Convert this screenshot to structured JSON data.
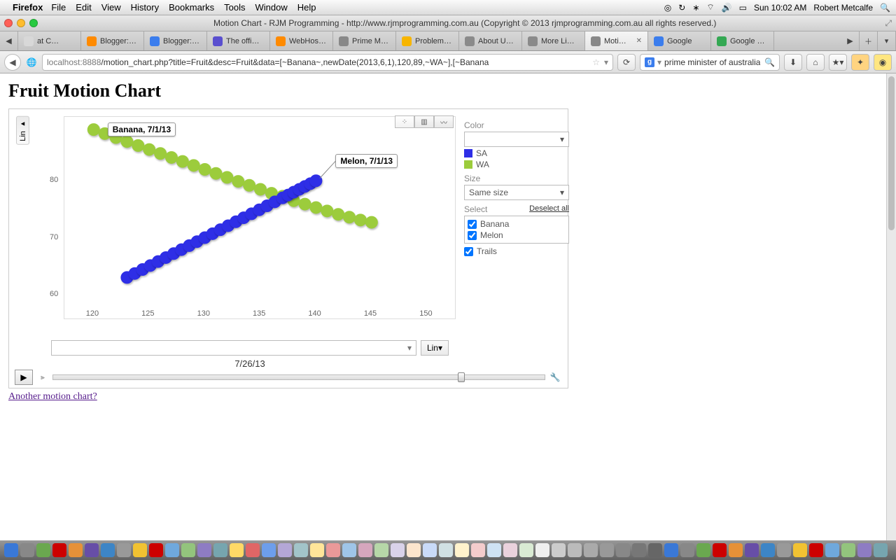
{
  "menubar": {
    "app": "Firefox",
    "items": [
      "File",
      "Edit",
      "View",
      "History",
      "Bookmarks",
      "Tools",
      "Window",
      "Help"
    ],
    "clock": "Sun 10:02 AM",
    "user": "Robert Metcalfe"
  },
  "window": {
    "title": "Motion Chart - RJM Programming - http://www.rjmprogramming.com.au (Copyright © 2013 rjmprogramming.com.au all rights reserved.)"
  },
  "tabs": {
    "items": [
      {
        "label": "at C…",
        "fav": "#d8d8d8"
      },
      {
        "label": "Blogger:…",
        "fav": "#ff8a00"
      },
      {
        "label": "Blogger:…",
        "fav": "#3b7ded"
      },
      {
        "label": "The offi…",
        "fav": "#5a4fcf"
      },
      {
        "label": "WebHos…",
        "fav": "#ff8a00"
      },
      {
        "label": "Prime M…",
        "fav": "#888"
      },
      {
        "label": "Problem…",
        "fav": "#f7b500"
      },
      {
        "label": "About U…",
        "fav": "#8a8a8a"
      },
      {
        "label": "More Li…",
        "fav": "#8a8a8a"
      },
      {
        "label": "Moti…",
        "fav": "#888",
        "active": true,
        "close": true
      },
      {
        "label": "Google",
        "fav": "#3b7ded"
      },
      {
        "label": "Google …",
        "fav": "#34a853"
      }
    ]
  },
  "url": {
    "host": "localhost",
    "port": ":8888",
    "path": "/motion_chart.php?title=Fruit&desc=Fruit&data=[~Banana~,newDate(2013,6,1),120,89,~WA~],[~Banana"
  },
  "search": {
    "engine_icon": "g",
    "query": "prime minister of australia"
  },
  "page": {
    "title": "Fruit Motion Chart",
    "link": "Another motion chart?"
  },
  "panel": {
    "color_label": "Color",
    "legend": [
      {
        "name": "SA",
        "color": "#2e2ee6"
      },
      {
        "name": "WA",
        "color": "#9ccc3c"
      }
    ],
    "size_label": "Size",
    "size_value": "Same size",
    "select_label": "Select",
    "deselect": "Deselect all",
    "items": [
      {
        "name": "Banana",
        "checked": true
      },
      {
        "name": "Melon",
        "checked": true
      }
    ],
    "trails": {
      "label": "Trails",
      "checked": true
    }
  },
  "axis": {
    "y_scale": "Lin",
    "x_scale": "Lin",
    "x_ticks": [
      120,
      125,
      130,
      135,
      140,
      145,
      150
    ],
    "y_ticks": [
      60,
      70,
      80
    ]
  },
  "timeline": {
    "date": "7/26/13",
    "pos": 0.83
  },
  "tooltips": {
    "banana": "Banana, 7/1/13",
    "melon": "Melon, 7/1/13"
  },
  "chart_data": {
    "type": "scatter",
    "title": "Fruit Motion Chart",
    "xlabel": "",
    "ylabel": "",
    "xlim": [
      118,
      152
    ],
    "ylim": [
      58,
      90
    ],
    "series": [
      {
        "name": "Banana (WA)",
        "color": "#9ccc3c",
        "points": [
          [
            120,
            89
          ],
          [
            121,
            88.3
          ],
          [
            122,
            87.6
          ],
          [
            123,
            86.9
          ],
          [
            124,
            86.2
          ],
          [
            125,
            85.5
          ],
          [
            126,
            84.8
          ],
          [
            127,
            84.1
          ],
          [
            128,
            83.4
          ],
          [
            129,
            82.7
          ],
          [
            130,
            82
          ],
          [
            131,
            81.3
          ],
          [
            132,
            80.6
          ],
          [
            133,
            79.9
          ],
          [
            134,
            79.2
          ],
          [
            135,
            78.5
          ],
          [
            136,
            77.8
          ],
          [
            137,
            77.3
          ],
          [
            138,
            76.5
          ],
          [
            139,
            75.9
          ],
          [
            140,
            75.3
          ],
          [
            141,
            74.7
          ],
          [
            142,
            74.1
          ],
          [
            143,
            73.6
          ],
          [
            144,
            73.1
          ],
          [
            145,
            72.7
          ]
        ]
      },
      {
        "name": "Melon (SA)",
        "color": "#2e2ee6",
        "points": [
          [
            123,
            63
          ],
          [
            123.7,
            63.7
          ],
          [
            124.4,
            64.4
          ],
          [
            125.1,
            65.1
          ],
          [
            125.8,
            65.8
          ],
          [
            126.5,
            66.5
          ],
          [
            127.2,
            67.2
          ],
          [
            127.9,
            67.9
          ],
          [
            128.6,
            68.6
          ],
          [
            129.3,
            69.3
          ],
          [
            130,
            70
          ],
          [
            130.7,
            70.7
          ],
          [
            131.4,
            71.4
          ],
          [
            132.1,
            72.1
          ],
          [
            132.8,
            72.8
          ],
          [
            133.5,
            73.5
          ],
          [
            134.2,
            74.2
          ],
          [
            134.9,
            74.9
          ],
          [
            135.6,
            75.6
          ],
          [
            136.3,
            76.3
          ],
          [
            137,
            77
          ],
          [
            137.5,
            77.5
          ],
          [
            138,
            78
          ],
          [
            138.5,
            78.5
          ],
          [
            139,
            79
          ],
          [
            139.5,
            79.5
          ],
          [
            140,
            80
          ]
        ]
      }
    ]
  }
}
